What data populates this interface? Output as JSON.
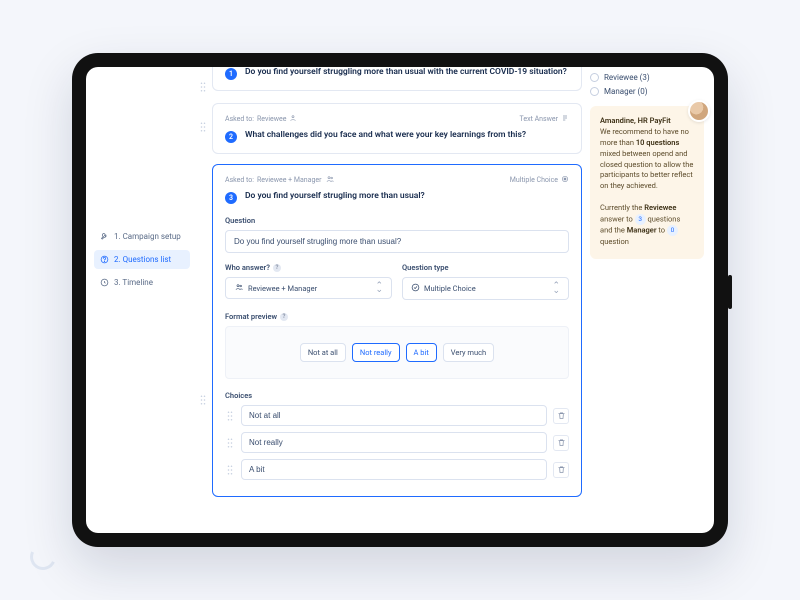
{
  "nav": {
    "items": [
      {
        "label": "1. Campaign setup"
      },
      {
        "label": "2. Questions list"
      },
      {
        "label": "3. Timeline"
      }
    ]
  },
  "questions": [
    {
      "number": "1",
      "title": "Do you find yourself struggling more than usual with the current COVID-19 situation?"
    },
    {
      "number": "2",
      "title": "What challenges did you face and what were your key learnings from this?",
      "asked_label": "Asked to:",
      "asked_value": "Reviewee",
      "type_label": "Text Answer"
    },
    {
      "number": "3",
      "title": "Do you find yourself strugling more than usual?",
      "asked_label": "Asked to:",
      "asked_value": "Reviewee + Manager",
      "type_label": "Multiple Choice"
    }
  ],
  "editor": {
    "question_label": "Question",
    "question_value": "Do you find yourself strugling more than usual?",
    "who_label": "Who answer?",
    "who_value": "Reviewee + Manager",
    "type_label": "Question type",
    "type_value": "Multiple Choice",
    "preview_label": "Format preview",
    "choices_label": "Choices",
    "options": [
      "Not at all",
      "Not really",
      "A bit",
      "Very much"
    ],
    "choices": [
      "Not at all",
      "Not really",
      "A bit"
    ]
  },
  "rside": {
    "radios": [
      {
        "label": "Reviewee (3)"
      },
      {
        "label": "Manager (0)"
      }
    ],
    "tip": {
      "author": "Amandine, HR PayFit",
      "line1": "We recommend to have no more than ",
      "bold1": "10 questions",
      "line2": " mixed between opend and closed question to allow the participants to better reflect on they achieved.",
      "line3a": "Currently the ",
      "bold2": "Reviewee",
      "line3b": " answer to ",
      "count1": "3",
      "line3c": " questions and the ",
      "bold3": "Manager",
      "line3d": " to ",
      "count2": "0",
      "line3e": " question"
    }
  }
}
